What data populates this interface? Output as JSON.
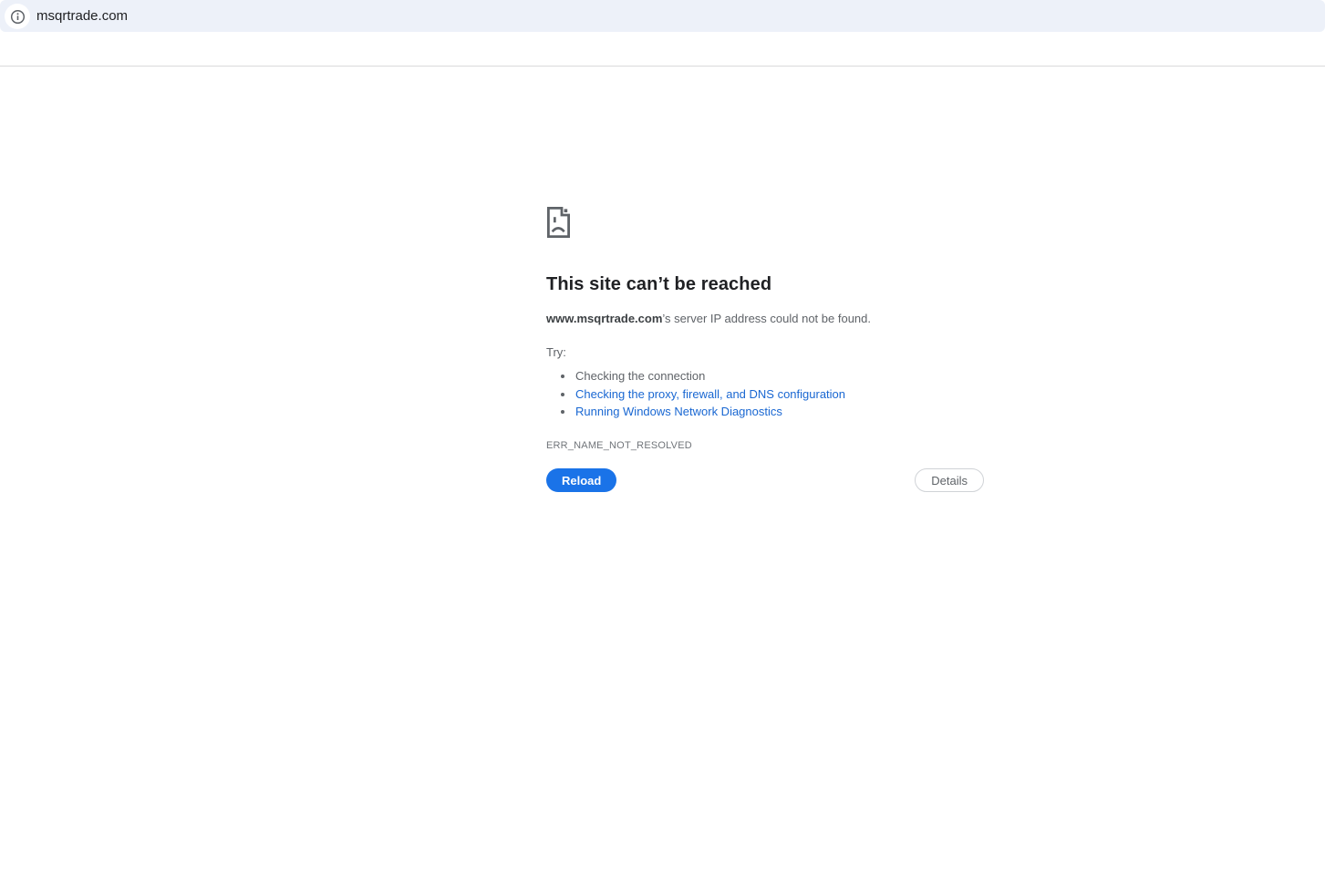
{
  "browser": {
    "address_bar": {
      "url": "msqrtrade.com",
      "icon": "info-icon"
    }
  },
  "error_page": {
    "icon": "sad-file-icon",
    "title": "This site can’t be reached",
    "description": {
      "domain": "www.msqrtrade.com",
      "rest": "’s server IP address could not be found."
    },
    "try_label": "Try:",
    "suggestions": [
      {
        "label": "Checking the connection",
        "link": false
      },
      {
        "label": "Checking the proxy, firewall, and DNS configuration",
        "link": true
      },
      {
        "label": "Running Windows Network Diagnostics",
        "link": true
      }
    ],
    "error_code": "ERR_NAME_NOT_RESOLVED",
    "reload_button": "Reload",
    "details_button": "Details"
  },
  "colors": {
    "toolbar_background": "#edf1f9",
    "primary_button": "#1a73e8",
    "link": "#1967d2",
    "text_primary": "#202124",
    "text_secondary": "#5f6368"
  }
}
